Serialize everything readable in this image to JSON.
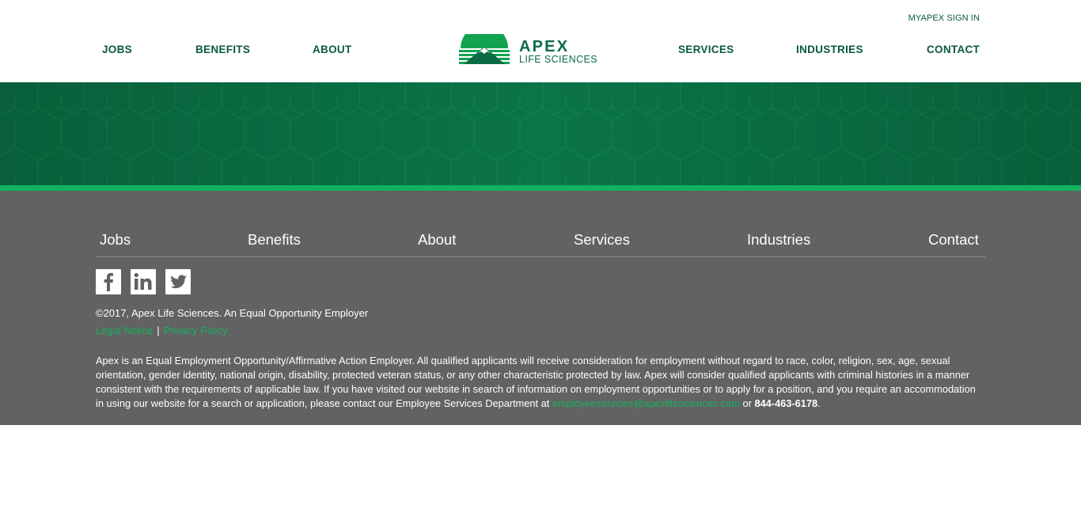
{
  "header": {
    "signin_label": "MYAPEX SIGN IN",
    "nav_left": [
      "JOBS",
      "BENEFITS",
      "ABOUT"
    ],
    "nav_right": [
      "SERVICES",
      "INDUSTRIES",
      "CONTACT"
    ],
    "logo": {
      "name": "APEX",
      "tagline": "LIFE SCIENCES"
    }
  },
  "colors": {
    "brand_green": "#0a5a3c",
    "banner_green": "#0b7448",
    "accent_green": "#11b160",
    "link_green": "#13b35c",
    "footer_gray": "#626264"
  },
  "footer": {
    "nav": [
      "Jobs",
      "Benefits",
      "About",
      "Services",
      "Industries",
      "Contact"
    ],
    "social": [
      "facebook-icon",
      "linkedin-icon",
      "twitter-icon"
    ],
    "copyright": "©2017, Apex Life Sciences. An Equal Opportunity Employer",
    "legal_links": [
      "Legal Notice",
      "Privacy Policy"
    ],
    "legal_separator": "|",
    "disclaimer_text": "Apex is an Equal Employment Opportunity/Affirmative Action Employer. All qualified applicants will receive consideration for employment without regard to race, color, religion, sex, age, sexual orientation, gender identity, national origin, disability, protected veteran status, or any other characteristic protected by law. Apex will consider qualified applicants with criminal histories in a manner consistent with the requirements of applicable law. If you have visited our website in search of information on employment opportunities or to apply for a position, and you require an accommodation in using our website for a search or application, please contact our Employee Services Department at",
    "email": "employeeservices@apexlifesciences.com",
    "or_text": "or",
    "phone": "844-463-6178",
    "end_punct": "."
  }
}
